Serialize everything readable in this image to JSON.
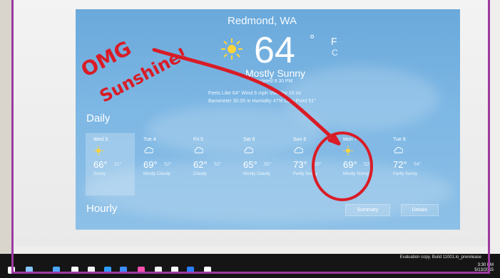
{
  "weather": {
    "location": "Redmond, WA",
    "temperature": "64",
    "degree_symbol": "°",
    "unit_f": "F",
    "unit_c": "C",
    "condition": "Mostly Sunny",
    "updated": "Updated 9:30 PM",
    "details": [
      "Feels Like 64°   Wind 6 mph   Visibility 10 mi",
      "Barometer 30.05 in   Humidity 47%   Dew Point 51°"
    ],
    "daily_label": "Daily",
    "hourly_label": "Hourly",
    "summary_label": "Summary",
    "details_label": "Details",
    "forecast": [
      {
        "day": "Wed 3",
        "icon": "sun-icon",
        "high": "66°",
        "low": "51°",
        "desc": "Sunny"
      },
      {
        "day": "Tue 4",
        "icon": "cloud-icon",
        "high": "69°",
        "low": "52°",
        "desc": "Mostly Cloudy"
      },
      {
        "day": "Fri 5",
        "icon": "cloud-icon",
        "high": "62°",
        "low": "52°",
        "desc": "Cloudy"
      },
      {
        "day": "Sat 6",
        "icon": "cloud-icon",
        "high": "65°",
        "low": "50°",
        "desc": "Mostly Cloudy"
      },
      {
        "day": "Sun 6",
        "icon": "cloud-icon",
        "high": "73°",
        "low": "55°",
        "desc": "Partly Sunny"
      },
      {
        "day": "Mon 7",
        "icon": "sun-icon",
        "high": "69°",
        "low": "52°",
        "desc": "Mostly Sunny"
      },
      {
        "day": "Tue 8",
        "icon": "cloud-icon",
        "high": "72°",
        "low": "54°",
        "desc": "Partly Sunny"
      }
    ]
  },
  "annotation": {
    "text1": "OMG",
    "text2": "Sunshine!"
  },
  "taskbar": {
    "build_text": "Evaluation copy. Build 11001.lo_prerelease",
    "time": "3:30 PM",
    "date": "5/13/2015"
  },
  "colors": {
    "frame": "#9d3aa1",
    "marker": "#d91c26",
    "weather_sky": "#7db7e4"
  }
}
